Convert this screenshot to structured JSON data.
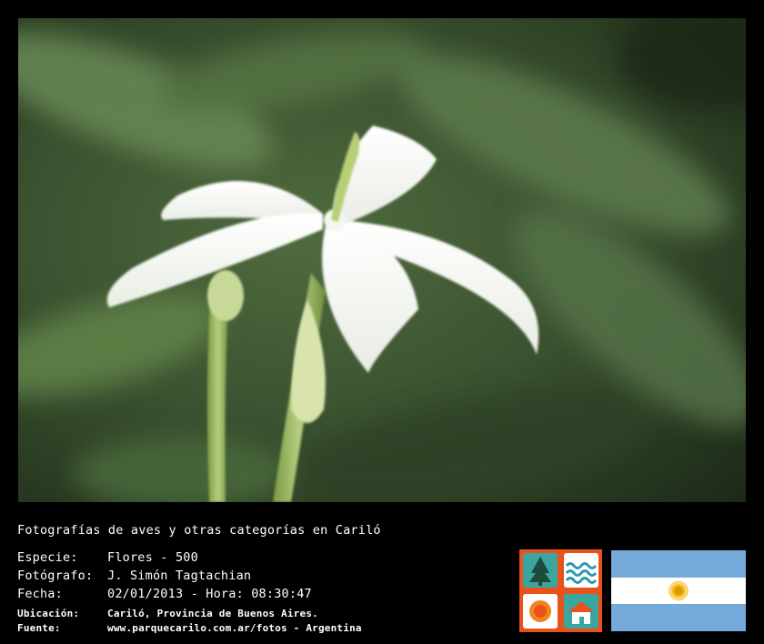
{
  "caption": {
    "title": "Fotografías de aves y otras categorías en Cariló",
    "especie_label": "Especie:",
    "especie_value": "Flores - 500",
    "fotografo_label": "Fotógrafo:",
    "fotografo_value": "J. Simón Tagtachian",
    "fecha_label": "Fecha:",
    "fecha_value": "02/01/2013 - Hora: 08:30:47",
    "ubicacion_label": "Ubicación:",
    "ubicacion_value": "Cariló, Provincia de Buenos Aires.",
    "fuente_label": "Fuente:",
    "fuente_value": "www.parquecarilo.com.ar/fotos - Argentina"
  },
  "colors": {
    "background": "#000000",
    "logo_orange": "#e8531c",
    "flag_blue": "#75aadb",
    "flag_white": "#ffffff",
    "sun": "#f6b40e"
  },
  "icons": [
    "pine-trees-icon",
    "waves-icon",
    "sun-icon",
    "house-icon",
    "argentina-flag"
  ]
}
